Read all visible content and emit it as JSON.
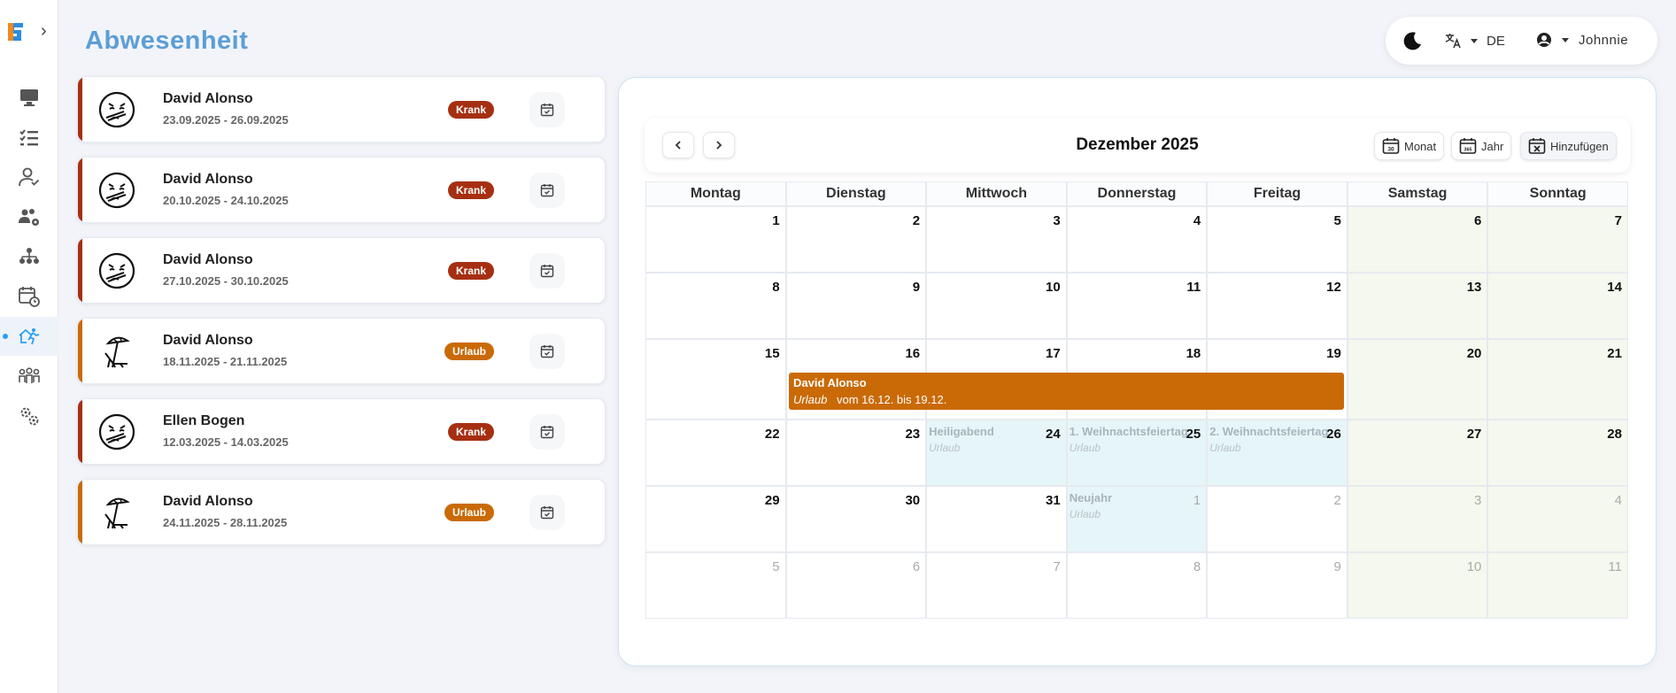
{
  "page": {
    "title": "Abwesenheit"
  },
  "sidebar": {
    "items": [
      {
        "name": "monitor-icon"
      },
      {
        "name": "checklist-icon"
      },
      {
        "name": "user-check-icon"
      },
      {
        "name": "users-gear-icon"
      },
      {
        "name": "sitemap-icon"
      },
      {
        "name": "calendar-clock-icon"
      },
      {
        "name": "absence-icon",
        "active": true
      },
      {
        "name": "team-icon"
      },
      {
        "name": "settings-icon"
      }
    ]
  },
  "topbar": {
    "language": "DE",
    "user": "Johnnie"
  },
  "absences": [
    {
      "name": "David Alonso",
      "dates": "23.09.2025 - 26.09.2025",
      "type": "Krank",
      "color": "#a62f12",
      "icon": "sick-face-icon"
    },
    {
      "name": "David Alonso",
      "dates": "20.10.2025 - 24.10.2025",
      "type": "Krank",
      "color": "#a62f12",
      "icon": "sick-face-icon"
    },
    {
      "name": "David Alonso",
      "dates": "27.10.2025 - 30.10.2025",
      "type": "Krank",
      "color": "#a62f12",
      "icon": "sick-face-icon"
    },
    {
      "name": "David Alonso",
      "dates": "18.11.2025 - 21.11.2025",
      "type": "Urlaub",
      "color": "#c96a07",
      "icon": "beach-chair-icon"
    },
    {
      "name": "Ellen Bogen",
      "dates": "12.03.2025 - 14.03.2025",
      "type": "Krank",
      "color": "#a62f12",
      "icon": "sick-face-icon"
    },
    {
      "name": "David Alonso",
      "dates": "24.11.2025 - 28.11.2025",
      "type": "Urlaub",
      "color": "#c96a07",
      "icon": "beach-chair-icon"
    }
  ],
  "calendar": {
    "month_label": "Dezember 2025",
    "buttons": {
      "month": "Monat",
      "year": "Jahr",
      "add": "Hinzufügen"
    },
    "icon_labels": {
      "month": "30",
      "year": "365"
    },
    "weekdays": [
      "Montag",
      "Dienstag",
      "Mittwoch",
      "Donnerstag",
      "Freitag",
      "Samstag",
      "Sonntag"
    ],
    "weeks": [
      [
        {
          "d": "1"
        },
        {
          "d": "2"
        },
        {
          "d": "3"
        },
        {
          "d": "4"
        },
        {
          "d": "5"
        },
        {
          "d": "6"
        },
        {
          "d": "7"
        }
      ],
      [
        {
          "d": "8"
        },
        {
          "d": "9"
        },
        {
          "d": "10"
        },
        {
          "d": "11"
        },
        {
          "d": "12"
        },
        {
          "d": "13"
        },
        {
          "d": "14"
        }
      ],
      [
        {
          "d": "15"
        },
        {
          "d": "16"
        },
        {
          "d": "17"
        },
        {
          "d": "18"
        },
        {
          "d": "19"
        },
        {
          "d": "20"
        },
        {
          "d": "21"
        }
      ],
      [
        {
          "d": "22"
        },
        {
          "d": "23"
        },
        {
          "d": "24",
          "holiday": "Heiligabend",
          "htype": "Urlaub"
        },
        {
          "d": "25",
          "holiday": "1. Weihnachtsfeiertag",
          "htype": "Urlaub"
        },
        {
          "d": "26",
          "holiday": "2. Weihnachtsfeiertag",
          "htype": "Urlaub"
        },
        {
          "d": "27"
        },
        {
          "d": "28"
        }
      ],
      [
        {
          "d": "29"
        },
        {
          "d": "30"
        },
        {
          "d": "31"
        },
        {
          "d": "1",
          "other": true,
          "holiday": "Neujahr",
          "htype": "Urlaub"
        },
        {
          "d": "2",
          "other": true
        },
        {
          "d": "3",
          "other": true
        },
        {
          "d": "4",
          "other": true
        }
      ],
      [
        {
          "d": "5",
          "other": true
        },
        {
          "d": "6",
          "other": true
        },
        {
          "d": "7",
          "other": true
        },
        {
          "d": "8",
          "other": true
        },
        {
          "d": "9",
          "other": true
        },
        {
          "d": "10",
          "other": true
        },
        {
          "d": "11",
          "other": true
        }
      ]
    ],
    "event": {
      "name": "David Alonso",
      "type": "Urlaub",
      "range": "vom 16.12. bis 19.12.",
      "color": "#c96a07"
    }
  }
}
